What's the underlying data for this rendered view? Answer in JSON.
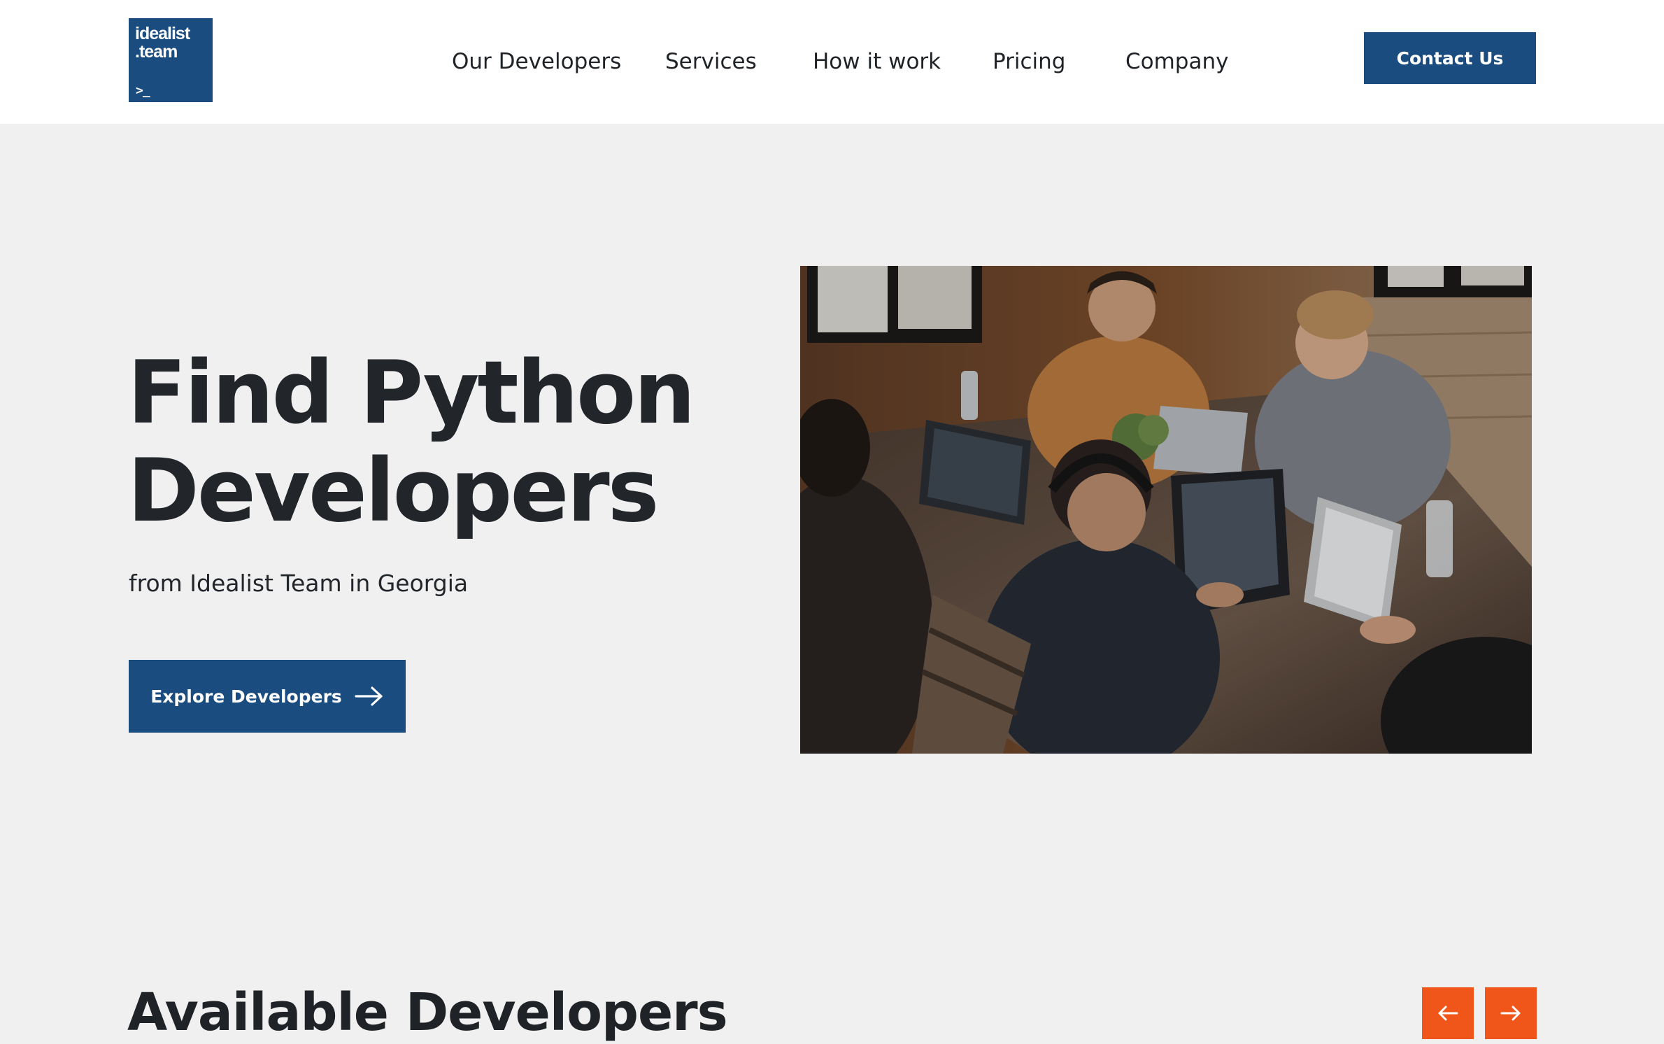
{
  "brand": {
    "logo_line1": "idealist",
    "logo_line2": ".team",
    "logo_prompt": ">_",
    "color": "#1a4c7f"
  },
  "nav": {
    "items": [
      {
        "label": "Our Developers"
      },
      {
        "label": "Services"
      },
      {
        "label": "How it work"
      },
      {
        "label": "Pricing"
      },
      {
        "label": "Company"
      }
    ],
    "contact_label": "Contact Us"
  },
  "hero": {
    "title_line1": "Find Python",
    "title_line2": "Developers",
    "subtitle": "from Idealist Team in Georgia",
    "cta_label": "Explore Developers",
    "cta_icon": "arrow-right-icon",
    "photo_alt": "Team of developers working on laptops around a wooden table"
  },
  "developers_section": {
    "title": "Available Developers",
    "prev_icon": "arrow-left-icon",
    "next_icon": "arrow-right-icon",
    "accent_color": "#f0561a"
  }
}
